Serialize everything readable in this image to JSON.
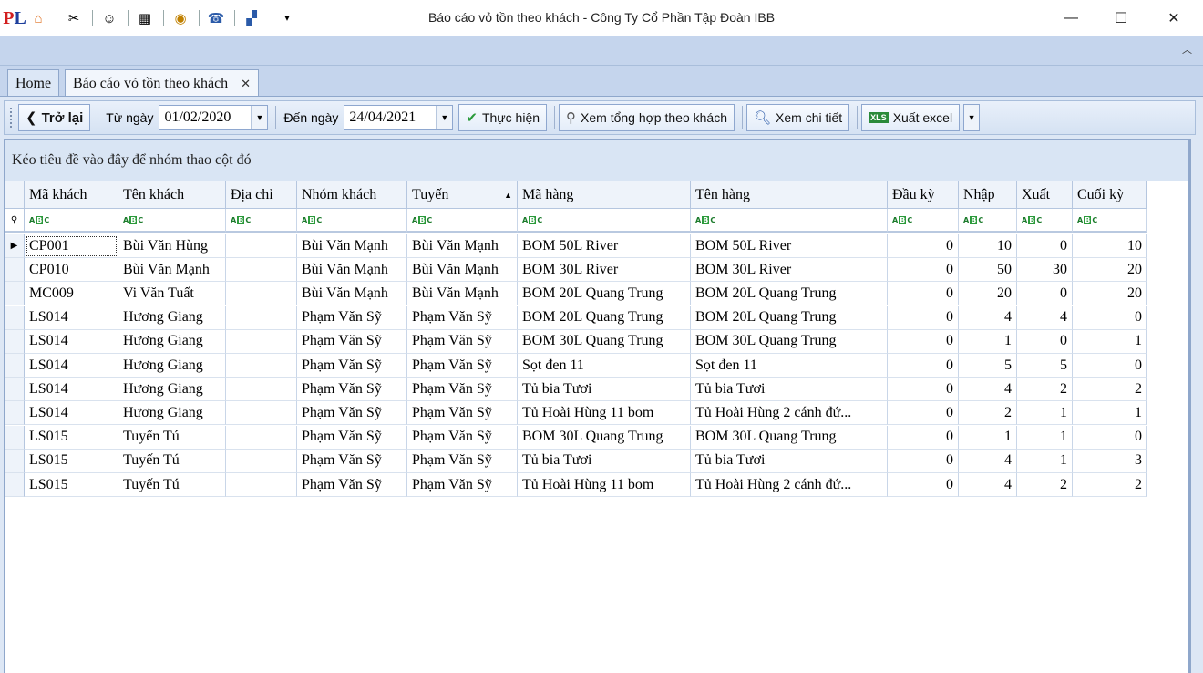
{
  "window": {
    "title": "Báo cáo vỏ tồn theo khách - Công Ty Cổ Phần Tập Đoàn IBB",
    "logo_letter": "P",
    "logo_accent": "L",
    "minimize": "—",
    "maximize": "☐",
    "close": "✕"
  },
  "tabs": [
    {
      "label": "Home"
    },
    {
      "label": "Báo cáo vỏ tồn theo khách",
      "close": "✕"
    }
  ],
  "toolbar": {
    "back_label": "Trở lại",
    "from_label": "Từ ngày",
    "from_value": "01/02/2020",
    "to_label": "Đến ngày",
    "to_value": "24/04/2021",
    "run_label": "Thực hiện",
    "summary_label": "Xem tổng hợp theo khách",
    "detail_label": "Xem chi tiết",
    "excel_label": "Xuất excel"
  },
  "grid": {
    "group_hint": "Kéo tiêu đề vào đây để nhóm thao cột đó",
    "columns": [
      "Mã khách",
      "Tên khách",
      "Địa chỉ",
      "Nhóm khách",
      "Tuyến",
      "Mã hàng",
      "Tên hàng",
      "Đầu kỳ",
      "Nhập",
      "Xuất",
      "Cuối kỳ"
    ],
    "rows": [
      [
        "CP001",
        "Bùi Văn Hùng",
        "",
        "Bùi Văn Mạnh",
        "Bùi Văn Mạnh",
        "BOM 50L River",
        "BOM 50L River",
        "0",
        "10",
        "0",
        "10"
      ],
      [
        "CP010",
        "Bùi Văn Mạnh",
        "",
        "Bùi Văn Mạnh",
        "Bùi Văn Mạnh",
        "BOM 30L River",
        "BOM 30L River",
        "0",
        "50",
        "30",
        "20"
      ],
      [
        "MC009",
        "Vi Văn Tuất",
        "",
        "Bùi Văn Mạnh",
        "Bùi Văn Mạnh",
        "BOM 20L Quang Trung",
        "BOM 20L Quang Trung",
        "0",
        "20",
        "0",
        "20"
      ],
      [
        "LS014",
        "Hương Giang",
        "",
        "Phạm Văn Sỹ",
        "Phạm Văn Sỹ",
        "BOM 20L Quang Trung",
        "BOM 20L Quang Trung",
        "0",
        "4",
        "4",
        "0"
      ],
      [
        "LS014",
        "Hương Giang",
        "",
        "Phạm Văn Sỹ",
        "Phạm Văn Sỹ",
        "BOM 30L Quang Trung",
        "BOM 30L Quang Trung",
        "0",
        "1",
        "0",
        "1"
      ],
      [
        "LS014",
        "Hương Giang",
        "",
        "Phạm Văn Sỹ",
        "Phạm Văn Sỹ",
        "Sọt đen 11",
        "Sọt đen 11",
        "0",
        "5",
        "5",
        "0"
      ],
      [
        "LS014",
        "Hương Giang",
        "",
        "Phạm Văn Sỹ",
        "Phạm Văn Sỹ",
        "Tủ bia Tươi",
        "Tủ bia Tươi",
        "0",
        "4",
        "2",
        "2"
      ],
      [
        "LS014",
        "Hương Giang",
        "",
        "Phạm Văn Sỹ",
        "Phạm Văn Sỹ",
        "Tủ Hoài Hùng 11 bom",
        "Tủ Hoài Hùng 2 cánh đứ...",
        "0",
        "2",
        "1",
        "1"
      ],
      [
        "LS015",
        "Tuyến Tú",
        "",
        "Phạm Văn Sỹ",
        "Phạm Văn Sỹ",
        "BOM 30L Quang Trung",
        "BOM 30L Quang Trung",
        "0",
        "1",
        "1",
        "0"
      ],
      [
        "LS015",
        "Tuyến Tú",
        "",
        "Phạm Văn Sỹ",
        "Phạm Văn Sỹ",
        "Tủ bia Tươi",
        "Tủ bia Tươi",
        "0",
        "4",
        "1",
        "3"
      ],
      [
        "LS015",
        "Tuyến Tú",
        "",
        "Phạm Văn Sỹ",
        "Phạm Văn Sỹ",
        "Tủ Hoài Hùng 11 bom",
        "Tủ Hoài Hùng 2 cánh đứ...",
        "0",
        "4",
        "2",
        "2"
      ]
    ]
  },
  "colors": {
    "ribbon": "#c5d5ed",
    "panel": "#dde7f5",
    "logo_blue": "#1e3f9c",
    "logo_red": "#d21e1e"
  }
}
